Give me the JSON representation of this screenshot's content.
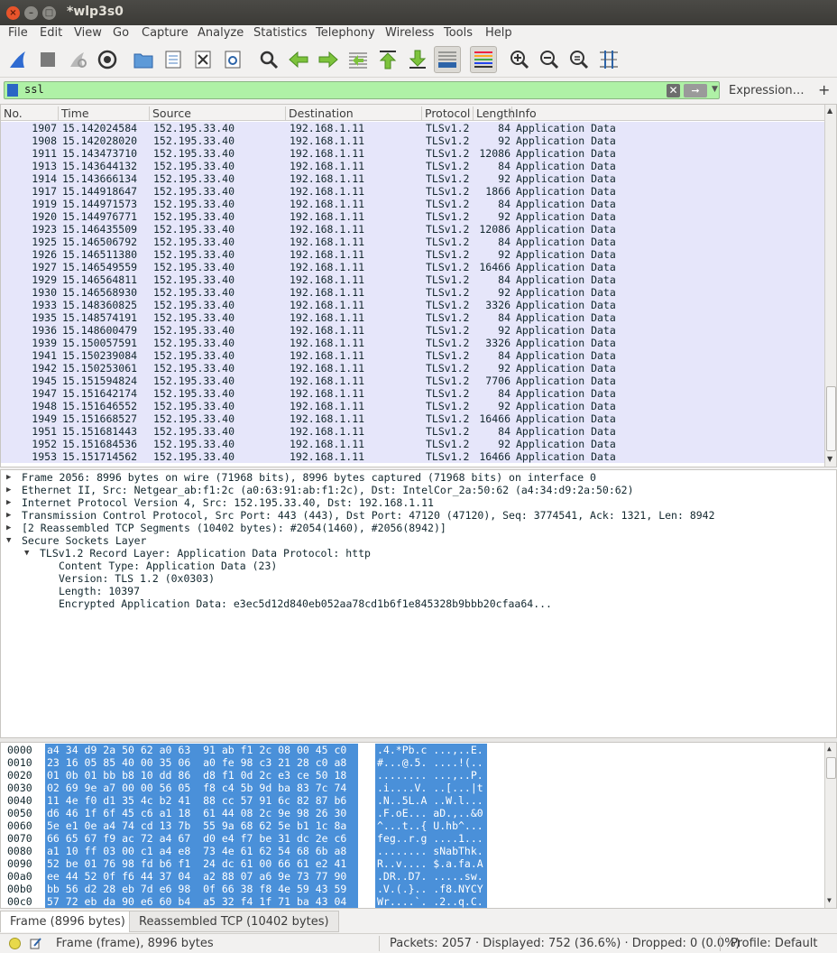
{
  "window": {
    "title": "*wlp3s0"
  },
  "menu": [
    "File",
    "Edit",
    "View",
    "Go",
    "Capture",
    "Analyze",
    "Statistics",
    "Telephony",
    "Wireless",
    "Tools",
    "Help"
  ],
  "filter": {
    "value": "ssl",
    "expression_label": "Expression…",
    "plus_label": "+"
  },
  "packet_list": {
    "columns": [
      "No.",
      "Time",
      "Source",
      "Destination",
      "Protocol",
      "Length",
      "Info"
    ],
    "rows": [
      [
        "1907",
        "15.142024584",
        "152.195.33.40",
        "192.168.1.11",
        "TLSv1.2",
        "84",
        "Application Data"
      ],
      [
        "1908",
        "15.142028020",
        "152.195.33.40",
        "192.168.1.11",
        "TLSv1.2",
        "92",
        "Application Data"
      ],
      [
        "1911",
        "15.143473710",
        "152.195.33.40",
        "192.168.1.11",
        "TLSv1.2",
        "12086",
        "Application Data"
      ],
      [
        "1913",
        "15.143644132",
        "152.195.33.40",
        "192.168.1.11",
        "TLSv1.2",
        "84",
        "Application Data"
      ],
      [
        "1914",
        "15.143666134",
        "152.195.33.40",
        "192.168.1.11",
        "TLSv1.2",
        "92",
        "Application Data"
      ],
      [
        "1917",
        "15.144918647",
        "152.195.33.40",
        "192.168.1.11",
        "TLSv1.2",
        "1866",
        "Application Data"
      ],
      [
        "1919",
        "15.144971573",
        "152.195.33.40",
        "192.168.1.11",
        "TLSv1.2",
        "84",
        "Application Data"
      ],
      [
        "1920",
        "15.144976771",
        "152.195.33.40",
        "192.168.1.11",
        "TLSv1.2",
        "92",
        "Application Data"
      ],
      [
        "1923",
        "15.146435509",
        "152.195.33.40",
        "192.168.1.11",
        "TLSv1.2",
        "12086",
        "Application Data"
      ],
      [
        "1925",
        "15.146506792",
        "152.195.33.40",
        "192.168.1.11",
        "TLSv1.2",
        "84",
        "Application Data"
      ],
      [
        "1926",
        "15.146511380",
        "152.195.33.40",
        "192.168.1.11",
        "TLSv1.2",
        "92",
        "Application Data"
      ],
      [
        "1927",
        "15.146549559",
        "152.195.33.40",
        "192.168.1.11",
        "TLSv1.2",
        "16466",
        "Application Data"
      ],
      [
        "1929",
        "15.146564811",
        "152.195.33.40",
        "192.168.1.11",
        "TLSv1.2",
        "84",
        "Application Data"
      ],
      [
        "1930",
        "15.146568930",
        "152.195.33.40",
        "192.168.1.11",
        "TLSv1.2",
        "92",
        "Application Data"
      ],
      [
        "1933",
        "15.148360825",
        "152.195.33.40",
        "192.168.1.11",
        "TLSv1.2",
        "3326",
        "Application Data"
      ],
      [
        "1935",
        "15.148574191",
        "152.195.33.40",
        "192.168.1.11",
        "TLSv1.2",
        "84",
        "Application Data"
      ],
      [
        "1936",
        "15.148600479",
        "152.195.33.40",
        "192.168.1.11",
        "TLSv1.2",
        "92",
        "Application Data"
      ],
      [
        "1939",
        "15.150057591",
        "152.195.33.40",
        "192.168.1.11",
        "TLSv1.2",
        "3326",
        "Application Data"
      ],
      [
        "1941",
        "15.150239084",
        "152.195.33.40",
        "192.168.1.11",
        "TLSv1.2",
        "84",
        "Application Data"
      ],
      [
        "1942",
        "15.150253061",
        "152.195.33.40",
        "192.168.1.11",
        "TLSv1.2",
        "92",
        "Application Data"
      ],
      [
        "1945",
        "15.151594824",
        "152.195.33.40",
        "192.168.1.11",
        "TLSv1.2",
        "7706",
        "Application Data"
      ],
      [
        "1947",
        "15.151642174",
        "152.195.33.40",
        "192.168.1.11",
        "TLSv1.2",
        "84",
        "Application Data"
      ],
      [
        "1948",
        "15.151646552",
        "152.195.33.40",
        "192.168.1.11",
        "TLSv1.2",
        "92",
        "Application Data"
      ],
      [
        "1949",
        "15.151668527",
        "152.195.33.40",
        "192.168.1.11",
        "TLSv1.2",
        "16466",
        "Application Data"
      ],
      [
        "1951",
        "15.151681443",
        "152.195.33.40",
        "192.168.1.11",
        "TLSv1.2",
        "84",
        "Application Data"
      ],
      [
        "1952",
        "15.151684536",
        "152.195.33.40",
        "192.168.1.11",
        "TLSv1.2",
        "92",
        "Application Data"
      ],
      [
        "1953",
        "15.151714562",
        "152.195.33.40",
        "192.168.1.11",
        "TLSv1.2",
        "16466",
        "Application Data"
      ]
    ],
    "row_color": "#e6e6fa"
  },
  "details": [
    {
      "text": "Frame 2056: 8996 bytes on wire (71968 bits), 8996 bytes captured (71968 bits) on interface 0",
      "level": 0,
      "state": "collapsed"
    },
    {
      "text": "Ethernet II, Src: Netgear_ab:f1:2c (a0:63:91:ab:f1:2c), Dst: IntelCor_2a:50:62 (a4:34:d9:2a:50:62)",
      "level": 0,
      "state": "collapsed"
    },
    {
      "text": "Internet Protocol Version 4, Src: 152.195.33.40, Dst: 192.168.1.11",
      "level": 0,
      "state": "collapsed"
    },
    {
      "text": "Transmission Control Protocol, Src Port: 443 (443), Dst Port: 47120 (47120), Seq: 3774541, Ack: 1321, Len: 8942",
      "level": 0,
      "state": "collapsed"
    },
    {
      "text": "[2 Reassembled TCP Segments (10402 bytes): #2054(1460), #2056(8942)]",
      "level": 0,
      "state": "collapsed"
    },
    {
      "text": "Secure Sockets Layer",
      "level": 0,
      "state": "expanded"
    },
    {
      "text": "TLSv1.2 Record Layer: Application Data Protocol: http",
      "level": 1,
      "state": "expanded"
    },
    {
      "text": "Content Type: Application Data (23)",
      "level": 2,
      "state": "leaf"
    },
    {
      "text": "Version: TLS 1.2 (0x0303)",
      "level": 2,
      "state": "leaf"
    },
    {
      "text": "Length: 10397",
      "level": 2,
      "state": "leaf"
    },
    {
      "text": "Encrypted Application Data: e3ec5d12d840eb052aa78cd1b6f1e845328b9bbb20cfaa64...",
      "level": 2,
      "state": "leaf"
    }
  ],
  "bytes": [
    [
      "0000",
      "a4 34 d9 2a 50 62 a0 63  91 ab f1 2c 08 00 45 c0",
      ".4.*Pb.c ...,..E."
    ],
    [
      "0010",
      "23 16 05 85 40 00 35 06  a0 fe 98 c3 21 28 c0 a8",
      "#...@.5. ....!(.."
    ],
    [
      "0020",
      "01 0b 01 bb b8 10 dd 86  d8 f1 0d 2c e3 ce 50 18",
      "........ ...,..P."
    ],
    [
      "0030",
      "02 69 9e a7 00 00 56 05  f8 c4 5b 9d ba 83 7c 74",
      ".i....V. ..[...|t"
    ],
    [
      "0040",
      "11 4e f0 d1 35 4c b2 41  88 cc 57 91 6c 82 87 b6",
      ".N..5L.A ..W.l..."
    ],
    [
      "0050",
      "d6 46 1f 6f 45 c6 a1 18  61 44 08 2c 9e 98 26 30",
      ".F.oE... aD.,..&0"
    ],
    [
      "0060",
      "5e e1 0e a4 74 cd 13 7b  55 9a 68 62 5e b1 1c 8a",
      "^...t..{ U.hb^..."
    ],
    [
      "0070",
      "66 65 67 f9 ac 72 a4 67  d0 e4 f7 be 31 dc 2e c6",
      "feg..r.g ....1..."
    ],
    [
      "0080",
      "a1 10 ff 03 00 c1 a4 e8  73 4e 61 62 54 68 6b a8",
      "........ sNabThk."
    ],
    [
      "0090",
      "52 be 01 76 98 fd b6 f1  24 dc 61 00 66 61 e2 41",
      "R..v.... $.a.fa.A"
    ],
    [
      "00a0",
      "ee 44 52 0f f6 44 37 04  a2 88 07 a6 9e 73 77 90",
      ".DR..D7. .....sw."
    ],
    [
      "00b0",
      "bb 56 d2 28 eb 7d e6 98  0f 66 38 f8 4e 59 43 59",
      ".V.(.}.. .f8.NYCY"
    ],
    [
      "00c0",
      "57 72 eb da 90 e6 60 b4  a5 32 f4 1f 71 ba 43 04",
      "Wr....`. .2..q.C."
    ]
  ],
  "byte_tabs": [
    "Frame (8996 bytes)",
    "Reassembled TCP (10402 bytes)"
  ],
  "status": {
    "frame": "Frame (frame), 8996 bytes",
    "packets": "Packets: 2057 · Displayed: 752 (36.6%) · Dropped: 0 (0.0%)",
    "profile": "Profile: Default"
  },
  "colors": {
    "filter_ok": "#aff1a6",
    "selection": "#4a90d9",
    "titlebar": "#3c3b37"
  }
}
